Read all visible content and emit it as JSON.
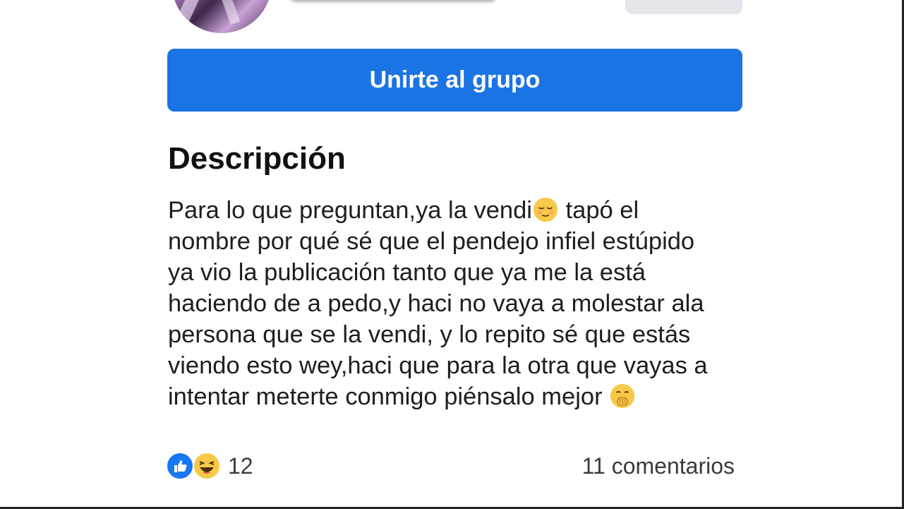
{
  "group": {
    "join_button_label": "Unirte al grupo"
  },
  "description": {
    "title": "Descripción",
    "lines": [
      "Para lo que preguntan,ya la vendi",
      "tapó el",
      "nombre por qué sé que el pendejo infiel estúpido",
      "ya vio la publicación tanto que ya me la está",
      "haciendo de a pedo,y haci no vaya a molestar ala",
      "persona que se la vendi, y lo repito sé que estás",
      "viendo esto wey,haci que para la otra que vayas a",
      "intentar meterte conmigo piénsalo mejor"
    ],
    "emojis": [
      "relieved-face-icon",
      "face-with-hand-over-mouth-icon"
    ]
  },
  "footer": {
    "reaction_icons": [
      "like-reaction-icon",
      "haha-reaction-icon"
    ],
    "reaction_count": "12",
    "comments_label": "11 comentarios"
  },
  "colors": {
    "primary_blue": "#1b74e4",
    "emoji_yellow": "#f7c948",
    "text": "#1c1e21"
  }
}
